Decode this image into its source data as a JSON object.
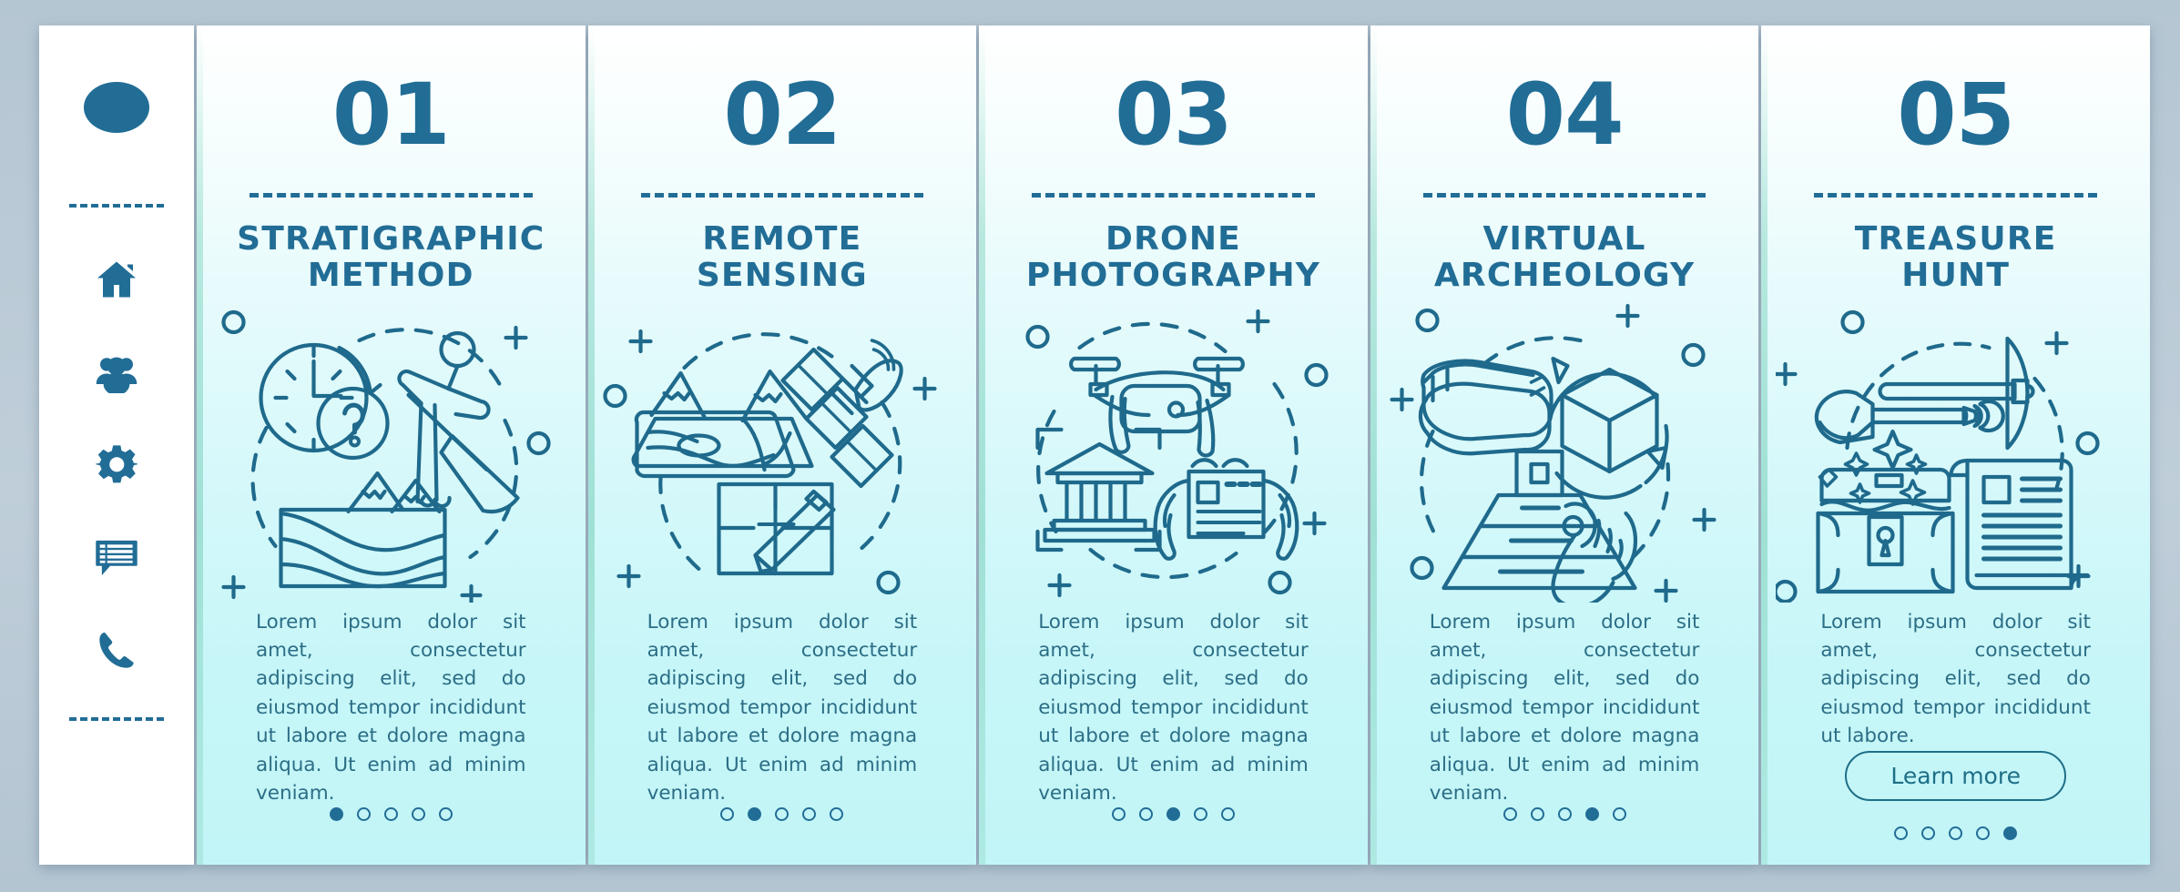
{
  "theme": {
    "accent": "#216d96",
    "text": "#2c6e86",
    "page_bg": "#b7c8d4",
    "card_top": "#ffffff",
    "card_bottom": "#c2f5f7"
  },
  "sidebar": {
    "logo": "logo-circle",
    "icons": [
      {
        "name": "home-icon",
        "label": "Home"
      },
      {
        "name": "users-icon",
        "label": "Users"
      },
      {
        "name": "gear-icon",
        "label": "Settings"
      },
      {
        "name": "chat-icon",
        "label": "Messages"
      },
      {
        "name": "phone-icon",
        "label": "Contact"
      }
    ]
  },
  "cards": [
    {
      "number": "01",
      "title": "STRATIGRAPHIC METHOD",
      "body": "Lorem ipsum dolor sit amet, consectetur adipiscing elit, sed do eiusmod tempor incididunt ut labore et dolore magna aliqua. Ut enim ad minim veniam.",
      "illustration": "stratigraphy-clock-digger-layers-illustration",
      "active_dot": 1,
      "dot_count": 5,
      "has_button": false,
      "button_label": ""
    },
    {
      "number": "02",
      "title": "REMOTE SENSING",
      "body": "Lorem ipsum dolor sit amet, consectetur adipiscing elit, sed do eiusmod tempor incididunt ut labore et dolore magna aliqua. Ut enim ad minim veniam.",
      "illustration": "satellite-terrain-map-pencil-illustration",
      "active_dot": 2,
      "dot_count": 5,
      "has_button": false,
      "button_label": ""
    },
    {
      "number": "03",
      "title": "DRONE PHOTOGRAPHY",
      "body": "Lorem ipsum dolor sit amet, consectetur adipiscing elit, sed do eiusmod tempor incididunt ut labore et dolore magna aliqua. Ut enim ad minim veniam.",
      "illustration": "drone-temple-tablet-illustration",
      "active_dot": 3,
      "dot_count": 5,
      "has_button": false,
      "button_label": ""
    },
    {
      "number": "04",
      "title": "VIRTUAL ARCHEOLOGY",
      "body": "Lorem ipsum dolor sit amet, consectetur adipiscing elit, sed do eiusmod tempor incididunt ut labore et dolore magna aliqua. Ut enim ad minim veniam.",
      "illustration": "vr-headset-cube-pyramid-hand-illustration",
      "active_dot": 4,
      "dot_count": 5,
      "has_button": false,
      "button_label": ""
    },
    {
      "number": "05",
      "title": "TREASURE HUNT",
      "body": "Lorem ipsum dolor sit amet, consectetur adipiscing elit, sed do eiusmod tempor incididunt ut labore.",
      "illustration": "shovel-pickaxe-chest-scroll-illustration",
      "active_dot": 5,
      "dot_count": 5,
      "has_button": true,
      "button_label": "Learn more"
    }
  ]
}
